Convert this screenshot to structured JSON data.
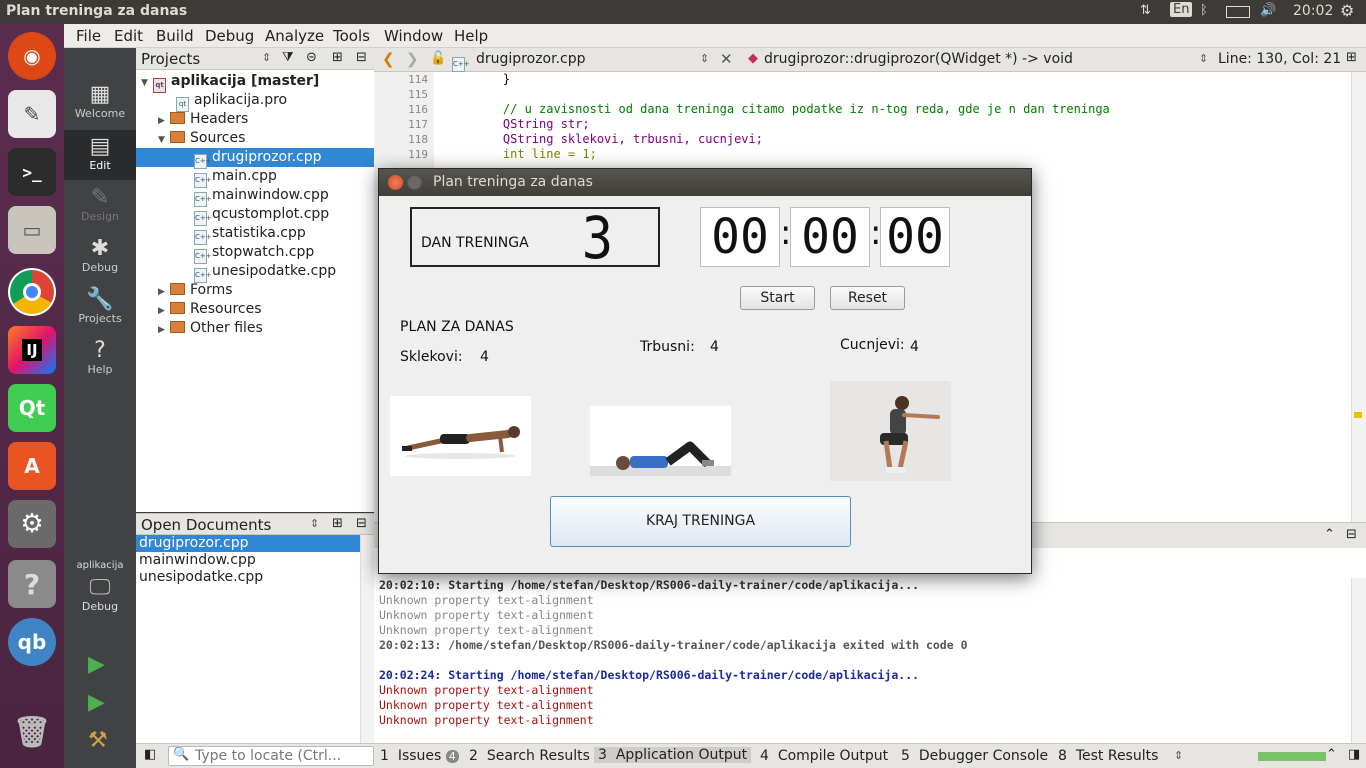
{
  "topbar": {
    "title": "Plan treninga za danas",
    "keyboard": "En",
    "time": "20:02"
  },
  "menu": [
    "File",
    "Edit",
    "Build",
    "Debug",
    "Analyze",
    "Tools",
    "Window",
    "Help"
  ],
  "modes": [
    {
      "label": "Welcome"
    },
    {
      "label": "Edit"
    },
    {
      "label": "Design"
    },
    {
      "label": "Debug"
    },
    {
      "label": "Projects"
    },
    {
      "label": "Help"
    }
  ],
  "kit": {
    "project": "aplikacija",
    "mode": "Debug"
  },
  "projects": {
    "header": "Projects",
    "root": "aplikacija [master]",
    "items": [
      "aplikacija.pro",
      "Headers",
      "Sources",
      "drugiprozor.cpp",
      "main.cpp",
      "mainwindow.cpp",
      "qcustomplot.cpp",
      "statistika.cpp",
      "stopwatch.cpp",
      "unesipodatke.cpp",
      "Forms",
      "Resources",
      "Other files"
    ]
  },
  "open_documents": {
    "header": "Open Documents",
    "items": [
      "drugiprozor.cpp",
      "mainwindow.cpp",
      "unesipodatke.cpp"
    ]
  },
  "editor": {
    "file": "drugiprozor.cpp",
    "symbol": "drugiprozor::drugiprozor(QWidget *) -> void",
    "position": "Line: 130, Col: 21",
    "lines": [
      {
        "n": "114",
        "t": "    }"
      },
      {
        "n": "115",
        "t": ""
      },
      {
        "n": "116",
        "t": "    // u zavisnosti od dana treninga citamo podatke iz n-tog reda, gde je n dan treninga"
      },
      {
        "n": "117",
        "t": "    QString str;"
      },
      {
        "n": "118",
        "t": "    QString sklekovi, trbusni, cucnjevi;"
      },
      {
        "n": "119",
        "t": "    int line = 1;"
      }
    ]
  },
  "output": {
    "lines": [
      "20:02:10: Starting /home/stefan/Desktop/RS006-daily-trainer/code/aplikacija...",
      "Unknown property text-alignment",
      "Unknown property text-alignment",
      "Unknown property text-alignment",
      "20:02:13: /home/stefan/Desktop/RS006-daily-trainer/code/aplikacija exited with code 0",
      "",
      "20:02:24: Starting /home/stefan/Desktop/RS006-daily-trainer/code/aplikacija...",
      "Unknown property text-alignment",
      "Unknown property text-alignment",
      "Unknown property text-alignment"
    ]
  },
  "statusbar": {
    "locate_placeholder": "Type to locate (Ctrl...",
    "tabs": [
      {
        "num": "1",
        "label": "Issues",
        "badge": "4"
      },
      {
        "num": "2",
        "label": "Search Results"
      },
      {
        "num": "3",
        "label": "Application Output"
      },
      {
        "num": "4",
        "label": "Compile Output"
      },
      {
        "num": "5",
        "label": "Debugger Console"
      },
      {
        "num": "8",
        "label": "Test Results"
      }
    ]
  },
  "dialog": {
    "title": "Plan treninga za danas",
    "day_label": "DAN TRENINGA",
    "day_value": "3",
    "timer": {
      "h": "00",
      "m": "00",
      "s": "00",
      "sep": ":"
    },
    "start": "Start",
    "reset": "Reset",
    "plan_heading": "PLAN ZA DANAS",
    "exercises": [
      {
        "label": "Sklekovi:",
        "value": "4"
      },
      {
        "label": "Trbusni:",
        "value": "4"
      },
      {
        "label": "Cucnjevi:",
        "value": "4"
      }
    ],
    "end_button": "KRAJ TRENINGA"
  }
}
